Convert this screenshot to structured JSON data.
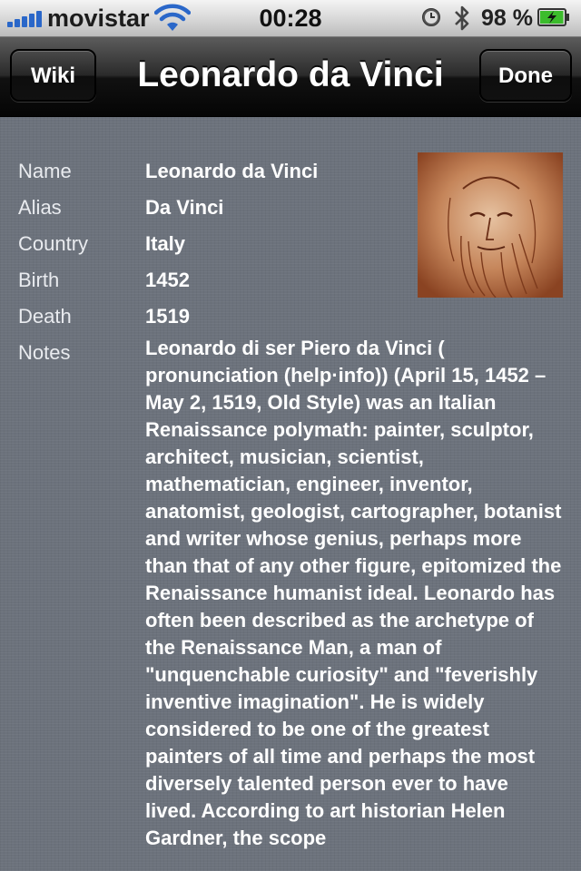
{
  "status_bar": {
    "carrier": "movistar",
    "time": "00:28",
    "battery_percent": "98 %",
    "battery_level": 0.98,
    "signal_bars": 5,
    "icons": [
      "signal-bars-icon",
      "wifi-icon",
      "clock-icon",
      "bluetooth-icon",
      "battery-icon"
    ],
    "colors": {
      "signal": "#2a67c9",
      "battery_fill": "#3cbc2c"
    }
  },
  "nav": {
    "title": "Leonardo da Vinci",
    "left_button": "Wiki",
    "right_button": "Done"
  },
  "fields": [
    {
      "label": "Name",
      "value": "Leonardo da Vinci"
    },
    {
      "label": "Alias",
      "value": "Da Vinci"
    },
    {
      "label": "Country",
      "value": "Italy"
    },
    {
      "label": "Birth",
      "value": "1452"
    },
    {
      "label": "Death",
      "value": "1519"
    }
  ],
  "notes": {
    "label": "Notes",
    "text": "Leonardo di ser Piero da Vinci ( pronunciation (help·info)) (April 15, 1452 – May 2, 1519, Old Style) was an Italian Renaissance polymath: painter, sculptor, architect, musician, scientist, mathematician, engineer, inventor, anatomist, geologist, cartographer, botanist and writer whose genius, perhaps more than that of any other figure, epitomized the Renaissance humanist ideal. Leonardo has often been described as the archetype of the Renaissance Man, a man of \"unquenchable curiosity\" and \"feverishly inventive imagination\". He is widely considered to be one of the greatest painters of all time and perhaps the most diversely talented person ever to have lived. According to art historian Helen Gardner, the scope"
  },
  "portrait": {
    "icon": "portrait-image"
  }
}
